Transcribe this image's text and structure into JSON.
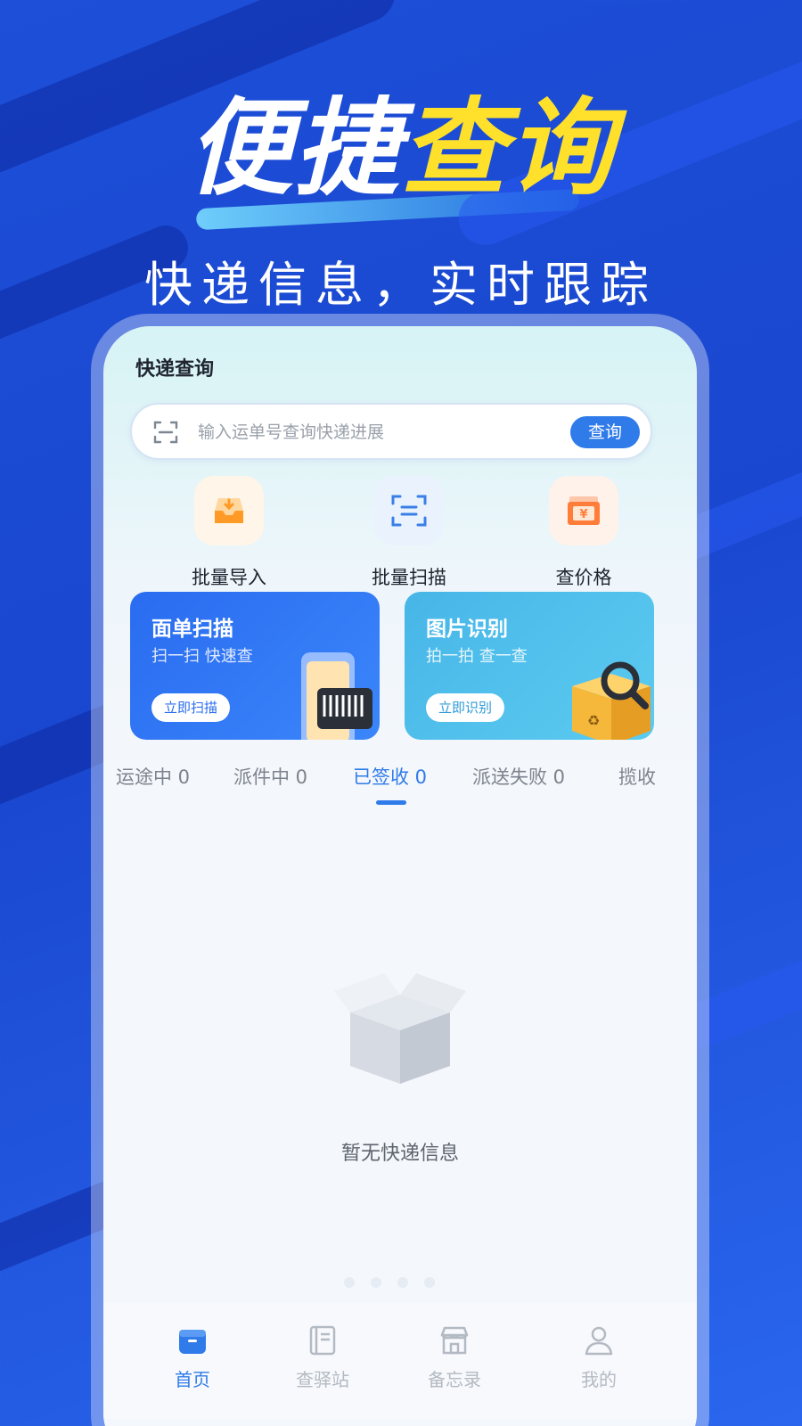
{
  "promo": {
    "headline_white": "便捷",
    "headline_yellow": "查询",
    "subline": "快递信息，实时跟踪"
  },
  "app": {
    "title": "快递查询",
    "search": {
      "placeholder": "输入运单号查询快递进展",
      "button_label": "查询"
    },
    "actions": [
      {
        "label": "批量导入",
        "icon": "inbox-download-icon"
      },
      {
        "label": "批量扫描",
        "icon": "scan-frame-icon"
      },
      {
        "label": "查价格",
        "icon": "yen-price-icon"
      }
    ],
    "cards": [
      {
        "title": "面单扫描",
        "subtitle": "扫一扫 快速查",
        "button": "立即扫描",
        "icon": "barcode-phone-icon"
      },
      {
        "title": "图片识别",
        "subtitle": "拍一拍 查一查",
        "button": "立即识别",
        "icon": "package-magnifier-icon"
      }
    ],
    "tabs": [
      {
        "label": "运途中 0"
      },
      {
        "label": "派件中 0"
      },
      {
        "label": "已签收 0",
        "active": true
      },
      {
        "label": "派送失败 0"
      },
      {
        "label": "揽收"
      }
    ],
    "empty_state": {
      "text": "暂无快递信息",
      "icon": "open-box-icon"
    },
    "navbar": [
      {
        "label": "首页",
        "icon": "home-box-icon",
        "active": true
      },
      {
        "label": "查驿站",
        "icon": "notebook-icon"
      },
      {
        "label": "备忘录",
        "icon": "store-icon"
      },
      {
        "label": "我的",
        "icon": "user-icon"
      }
    ]
  },
  "colors": {
    "background": "#1d4fd8",
    "accent_yellow": "#ffe02a",
    "primary_blue": "#2f7bea",
    "card_blue": "#2a6cf0",
    "card_cyan": "#47b6e8"
  }
}
